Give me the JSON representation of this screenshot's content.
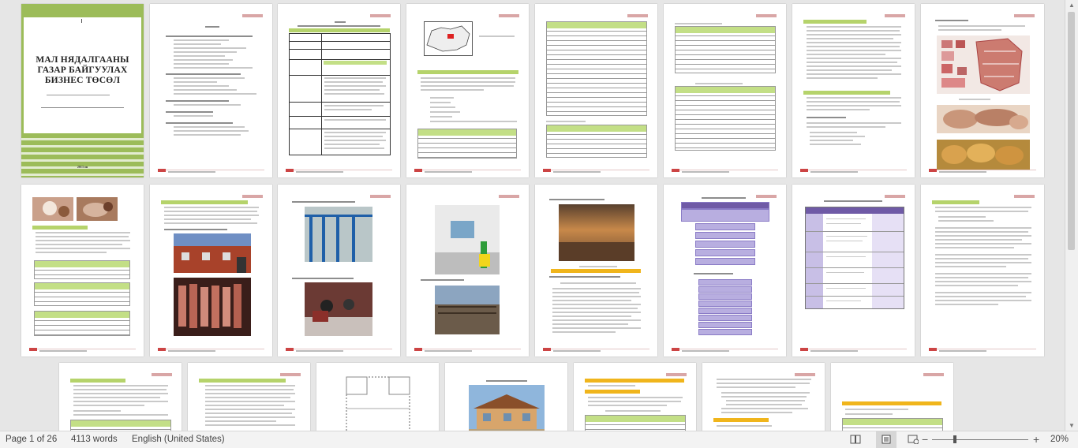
{
  "document": {
    "cover_title": "МАЛ НЯДАЛГААНЫ ГАЗАР БАЙГУУЛАХ БИЗНЕС ТӨСӨЛ",
    "cover_year": "2013 он"
  },
  "statusbar": {
    "page_info": "Page 1 of 26",
    "word_count": "4113 words",
    "language": "English (United States)",
    "zoom_level": "20%",
    "zoom_out": "−",
    "zoom_in": "+"
  },
  "colors": {
    "cover_green": "#9cbc59",
    "table_green": "#c3df86",
    "highlight_yellow": "#f0b51c",
    "diagram_purple": "#b8aee0"
  }
}
